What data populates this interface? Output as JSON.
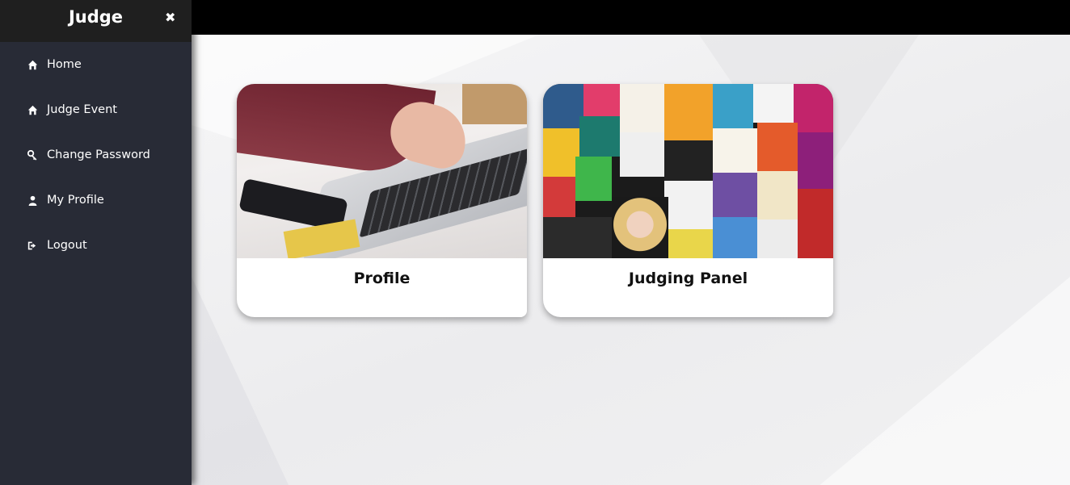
{
  "sidebar": {
    "title": "Judge",
    "close_glyph": "✖",
    "items": [
      {
        "label": "Home",
        "icon": "home-icon"
      },
      {
        "label": "Judge Event",
        "icon": "home-icon"
      },
      {
        "label": "Change Password",
        "icon": "key-icon"
      },
      {
        "label": "My Profile",
        "icon": "user-icon"
      },
      {
        "label": "Logout",
        "icon": "sign-out-icon"
      }
    ]
  },
  "cards": [
    {
      "title": "Profile",
      "image": "laptop-photo"
    },
    {
      "title": "Judging Panel",
      "image": "poster-collage-photo"
    }
  ],
  "colors": {
    "sidebar_bg": "#282b36",
    "sidebar_header_bg": "#1f1f1f",
    "topbar_bg": "#000000",
    "text_light": "#ffffff"
  }
}
